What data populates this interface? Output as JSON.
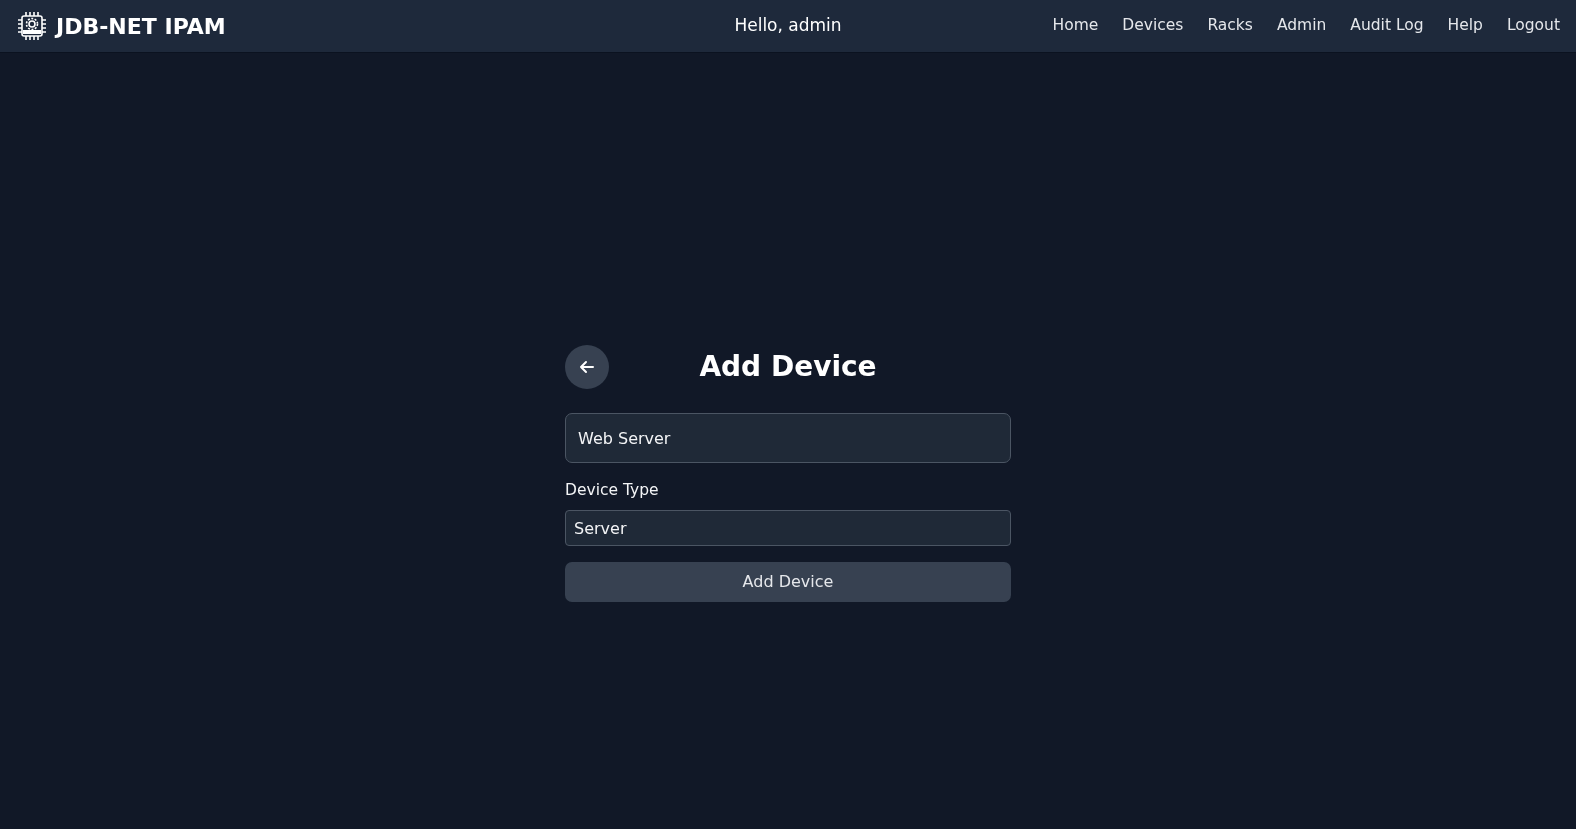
{
  "navbar": {
    "brand": "JDB-NET IPAM",
    "greeting": "Hello, admin",
    "links": [
      {
        "label": "Home"
      },
      {
        "label": "Devices"
      },
      {
        "label": "Racks"
      },
      {
        "label": "Admin"
      },
      {
        "label": "Audit Log"
      },
      {
        "label": "Help"
      },
      {
        "label": "Logout"
      }
    ]
  },
  "form": {
    "title": "Add Device",
    "name_field": {
      "value": "Web Server"
    },
    "type_field": {
      "label": "Device Type",
      "value": "Server"
    },
    "submit": "Add Device"
  }
}
